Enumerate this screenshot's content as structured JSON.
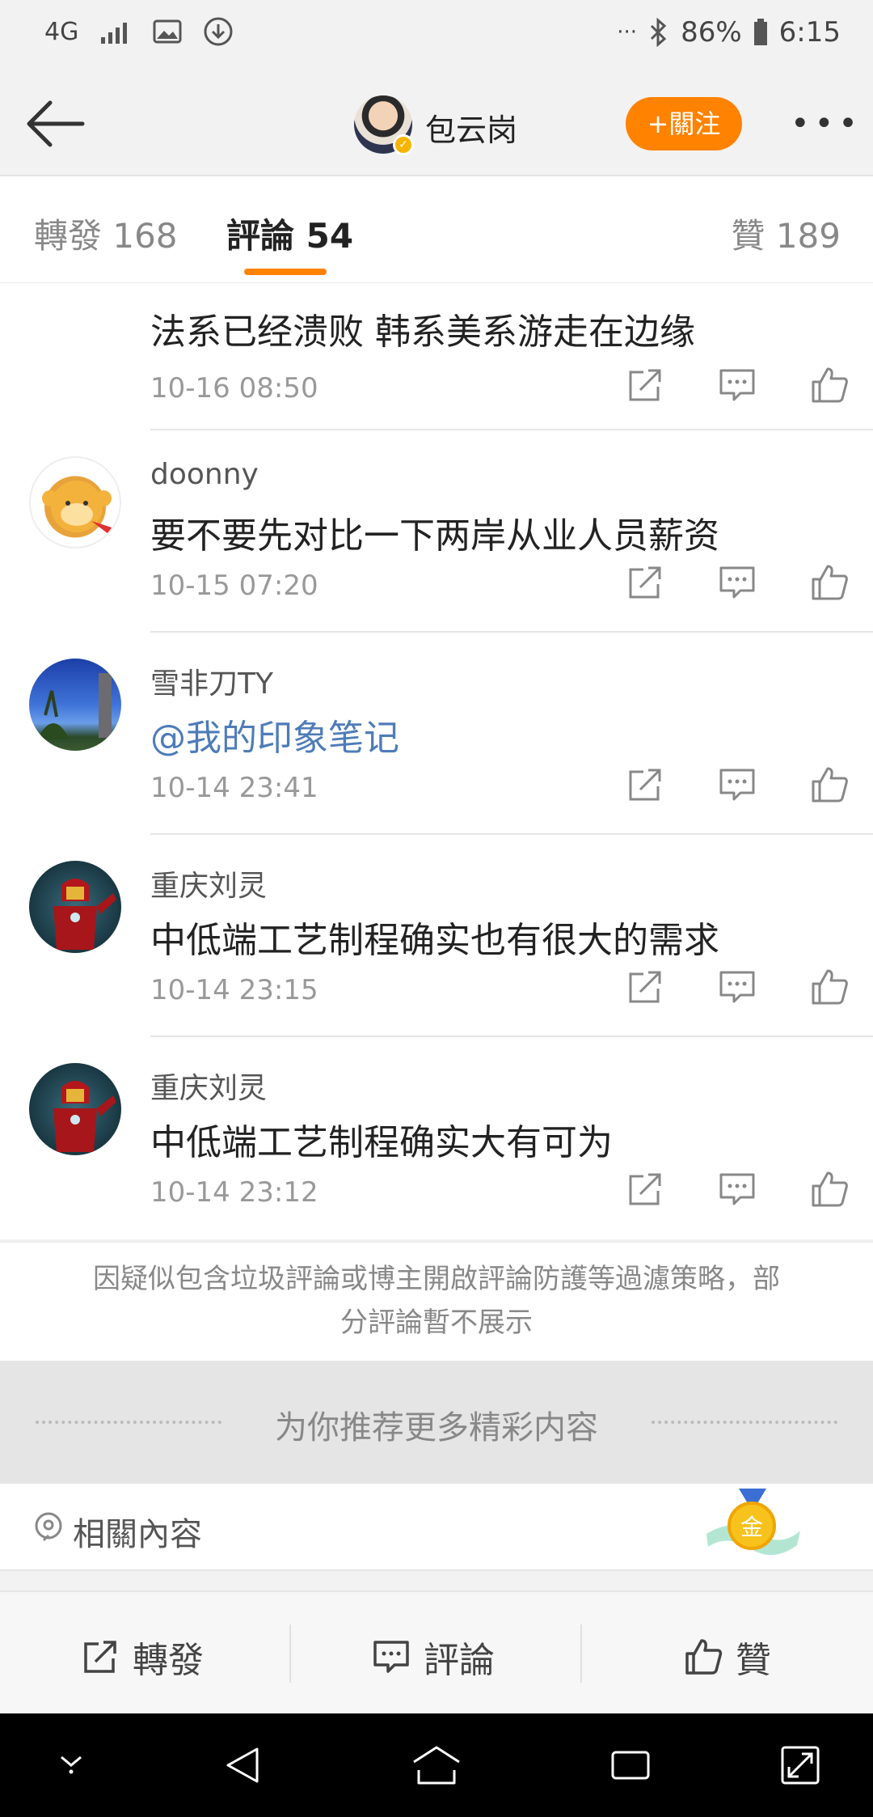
{
  "status_bar": {
    "network": "4G",
    "battery": "86%",
    "time": "6:15",
    "more": "···"
  },
  "header": {
    "author": "包云岗",
    "follow_label": "+關注",
    "more": "•••"
  },
  "tabs": {
    "repost": "轉發 168",
    "comment": "評論 54",
    "like": "贊 189"
  },
  "comments": [
    {
      "name": "",
      "text": "法系已经溃败  韩系美系游走在边缘",
      "time": "10-16 08:50"
    },
    {
      "name": "doonny",
      "text": "要不要先对比一下两岸从业人员薪资",
      "time": "10-15 07:20"
    },
    {
      "name": "雪非刀TY",
      "text": "@我的印象笔记",
      "time": "10-14 23:41"
    },
    {
      "name": "重庆刘灵",
      "text": "中低端工艺制程确实也有很大的需求",
      "time": "10-14 23:15"
    },
    {
      "name": "重庆刘灵",
      "text": "中低端工艺制程确实大有可为",
      "time": "10-14 23:12"
    }
  ],
  "notice": {
    "line1": "因疑似包含垃圾評論或博主開啟評論防護等過濾策略，部",
    "line2": "分評論暫不展示"
  },
  "recommend": {
    "title": "为你推荐更多精彩内容"
  },
  "related": {
    "label": "相關內容",
    "medal_char": "金"
  },
  "bottom_bar": {
    "repost": "轉發",
    "comment": "評論",
    "like": "贊"
  },
  "colors": {
    "accent": "#ff8200",
    "link": "#4e7cb8"
  }
}
